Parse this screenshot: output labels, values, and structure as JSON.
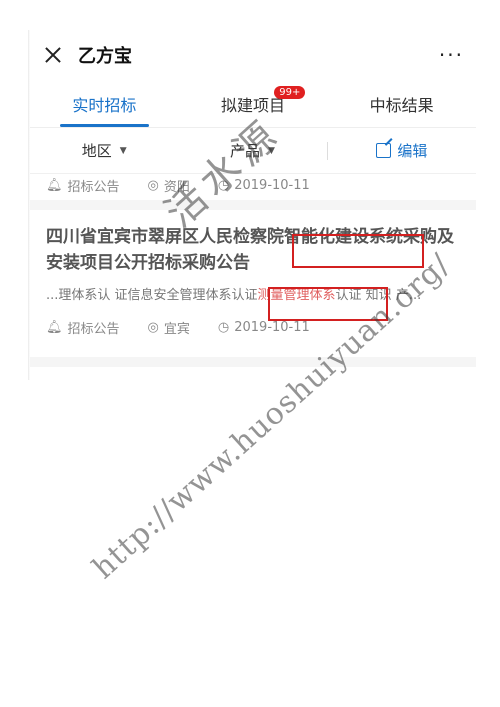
{
  "header": {
    "title": "乙方宝",
    "more": "···"
  },
  "tabs": [
    {
      "label": "实时招标",
      "active": true
    },
    {
      "label": "拟建项目",
      "badge": "99+"
    },
    {
      "label": "中标结果"
    }
  ],
  "filters": {
    "region": "地区",
    "product": "产品",
    "edit": "编辑"
  },
  "previous_item": {
    "type": "招标公告",
    "location": "资阳",
    "date": "2019-10-11"
  },
  "item": {
    "title": "四川省宜宾市翠屏区人民检察院智能化建设系统采购及安装项目公开招标采购公告",
    "snippet_before": "...理体系认 证信息安全管理体系认证",
    "snippet_highlight": "测量管理体系",
    "snippet_after": "认证 知识 产...",
    "type": "招标公告",
    "location": "宜宾",
    "date": "2019-10-11"
  },
  "watermark": {
    "cn": "活水源",
    "url": "http://www.huoshuiyuan.org/"
  },
  "colors": {
    "accent": "#1a73c9",
    "badge": "#e02020",
    "highlight": "#e06060",
    "annotation": "#d32020"
  }
}
